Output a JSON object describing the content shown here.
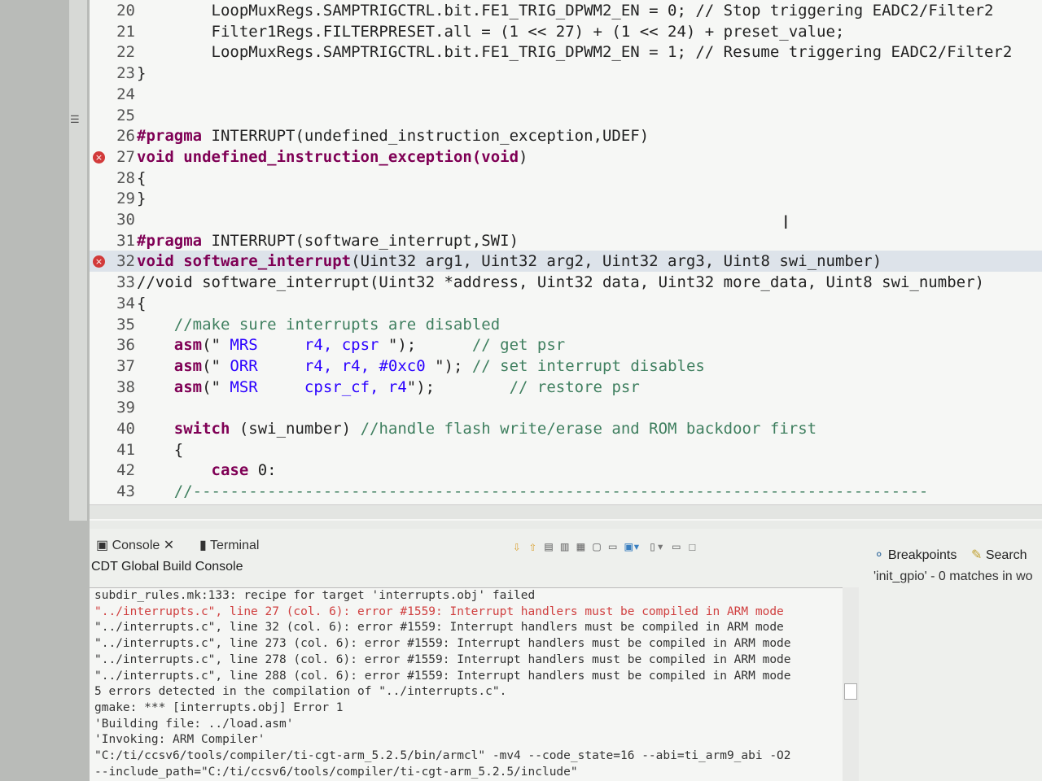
{
  "editor": {
    "lines": [
      {
        "n": "20",
        "t": [
          [
            "        LoopMuxRegs.SAMPTRIGCTRL.bit.FE1_TRIG_DPWM2_EN = 0; ",
            ""
          ],
          [
            "// Stop triggering EADC2/Filter2",
            ""
          ]
        ]
      },
      {
        "n": "21",
        "t": [
          [
            "        Filter1Regs.FILTERPRESET.all = (1 << 27) + (1 << 24) + preset_value;",
            ""
          ]
        ]
      },
      {
        "n": "22",
        "t": [
          [
            "        LoopMuxRegs.SAMPTRIGCTRL.bit.FE1_TRIG_DPWM2_EN = 1; ",
            ""
          ],
          [
            "// Resume triggering EADC2/Filter2",
            ""
          ]
        ]
      },
      {
        "n": "23",
        "t": [
          [
            "}",
            ""
          ]
        ]
      },
      {
        "n": "24",
        "t": []
      },
      {
        "n": "25",
        "t": []
      },
      {
        "n": "26",
        "t": [
          [
            "#pragma",
            "p"
          ],
          [
            " INTERRUPT(undefined_instruction_exception,UDEF)",
            ""
          ]
        ]
      },
      {
        "n": "27",
        "err": true,
        "t": [
          [
            "void",
            "k"
          ],
          [
            " ",
            ""
          ],
          [
            "undefined_instruction_exception",
            "k"
          ],
          [
            "(",
            "k"
          ],
          [
            "void",
            "k"
          ],
          [
            ")",
            ""
          ]
        ]
      },
      {
        "n": "28",
        "t": [
          [
            "{",
            ""
          ]
        ]
      },
      {
        "n": "29",
        "t": [
          [
            "}",
            ""
          ]
        ]
      },
      {
        "n": "30",
        "t": []
      },
      {
        "n": "31",
        "t": [
          [
            "#pragma",
            "p"
          ],
          [
            " INTERRUPT(software_interrupt,SWI)",
            ""
          ]
        ]
      },
      {
        "n": "32",
        "err": true,
        "hl": true,
        "t": [
          [
            "void",
            "k"
          ],
          [
            " ",
            ""
          ],
          [
            "software_interrupt",
            "k"
          ],
          [
            "(Uint32 arg1, Uint32 arg2, Uint32 arg3, Uint8 swi_number)",
            ""
          ]
        ]
      },
      {
        "n": "33",
        "t": [
          [
            "//void software_interrupt(Uint32 *address, Uint32 data, Uint32 more_data, Uint8 swi_number)",
            ""
          ]
        ]
      },
      {
        "n": "34",
        "t": [
          [
            "{",
            ""
          ]
        ]
      },
      {
        "n": "35",
        "t": [
          [
            "    ",
            ""
          ],
          [
            "//make sure interrupts are disabled",
            "c"
          ]
        ]
      },
      {
        "n": "36",
        "t": [
          [
            "    ",
            ""
          ],
          [
            "asm",
            "k"
          ],
          [
            "(\"",
            ""
          ],
          [
            " MRS     r4, cpsr ",
            "s"
          ],
          [
            "\");      ",
            ""
          ],
          [
            "// get psr",
            "c"
          ]
        ]
      },
      {
        "n": "37",
        "t": [
          [
            "    ",
            ""
          ],
          [
            "asm",
            "k"
          ],
          [
            "(\"",
            ""
          ],
          [
            " ORR     r4, r4, #0xc0 ",
            "s"
          ],
          [
            "\"); ",
            ""
          ],
          [
            "// set interrupt disables",
            "c"
          ]
        ]
      },
      {
        "n": "38",
        "t": [
          [
            "    ",
            ""
          ],
          [
            "asm",
            "k"
          ],
          [
            "(\"",
            ""
          ],
          [
            " MSR     cpsr_cf, r4",
            "s"
          ],
          [
            "\");        ",
            ""
          ],
          [
            "// restore psr",
            "c"
          ]
        ]
      },
      {
        "n": "39",
        "t": []
      },
      {
        "n": "40",
        "t": [
          [
            "    ",
            ""
          ],
          [
            "switch",
            "k"
          ],
          [
            " (swi_number) ",
            ""
          ],
          [
            "//handle flash write/erase and ROM backdoor first",
            "c"
          ]
        ]
      },
      {
        "n": "41",
        "t": [
          [
            "    {",
            ""
          ]
        ]
      },
      {
        "n": "42",
        "t": [
          [
            "        ",
            ""
          ],
          [
            "case",
            "k"
          ],
          [
            " 0:",
            ""
          ]
        ]
      },
      {
        "n": "43",
        "t": [
          [
            "    ",
            ""
          ],
          [
            "//-------------------------------------------------------------------------------",
            "c"
          ]
        ]
      }
    ]
  },
  "console": {
    "tabs": [
      "Console",
      "Terminal"
    ],
    "title": "CDT Global Build Console",
    "log": [
      {
        "text": "subdir_rules.mk:133: recipe for target 'interrupts.obj' failed"
      },
      {
        "text": "\"../interrupts.c\", line 27 (col. 6): error #1559: Interrupt handlers must be compiled in ARM mode",
        "red": true
      },
      {
        "text": "\"../interrupts.c\", line 32 (col. 6): error #1559: Interrupt handlers must be compiled in ARM mode"
      },
      {
        "text": "\"../interrupts.c\", line 273 (col. 6): error #1559: Interrupt handlers must be compiled in ARM mode"
      },
      {
        "text": "\"../interrupts.c\", line 278 (col. 6): error #1559: Interrupt handlers must be compiled in ARM mode"
      },
      {
        "text": "\"../interrupts.c\", line 288 (col. 6): error #1559: Interrupt handlers must be compiled in ARM mode"
      },
      {
        "text": "5 errors detected in the compilation of \"../interrupts.c\"."
      },
      {
        "text": "gmake: *** [interrupts.obj] Error 1"
      },
      {
        "text": "'Building file: ../load.asm'"
      },
      {
        "text": "'Invoking: ARM Compiler'"
      },
      {
        "text": "\"C:/ti/ccsv6/tools/compiler/ti-cgt-arm_5.2.5/bin/armcl\" -mv4 --code_state=16 --abi=ti_arm9_abi -O2"
      },
      {
        "text": "--include_path=\"C:/ti/ccsv6/tools/compiler/ti-cgt-arm_5.2.5/include\""
      }
    ]
  },
  "right_panel": {
    "tabs": [
      "Breakpoints",
      "Search"
    ],
    "message": "'init_gpio' - 0 matches in wo"
  },
  "colors": {
    "keyword": "#7f0055",
    "comment": "#3f7f5f",
    "string": "#2a00ff",
    "error": "#d04040"
  }
}
